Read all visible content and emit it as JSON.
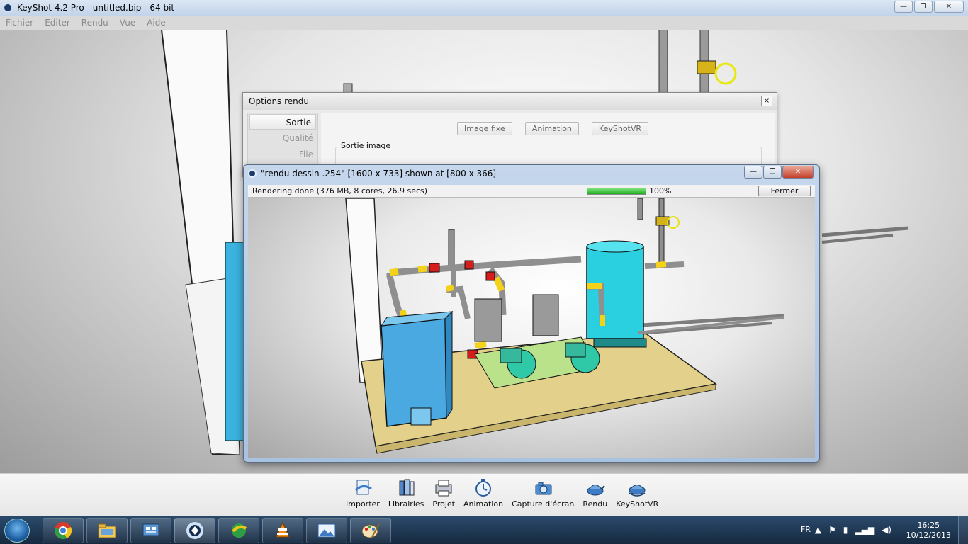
{
  "window": {
    "title": "KeyShot 4.2 Pro  - untitled.bip  - 64 bit",
    "minimize": "—",
    "maximize": "❐",
    "close": "✕"
  },
  "menu": {
    "items": [
      "Fichier",
      "Editer",
      "Rendu",
      "Vue",
      "Aide"
    ]
  },
  "options_dialog": {
    "title": "Options rendu",
    "close": "×",
    "sidebar": [
      "Sortie",
      "Qualité",
      "File"
    ],
    "tabs": [
      "Image fixe",
      "Animation",
      "KeyShotVR"
    ],
    "group_label": "Sortie image"
  },
  "render_window": {
    "title": "\"rendu dessin .254\" [1600 x 733] shown at [800 x 366]",
    "status": "Rendering done (376 MB, 8 cores, 26.9 secs)",
    "progress": 1.0,
    "progress_label": "100%",
    "close_button": "Fermer",
    "minimize": "—",
    "maximize": "❐",
    "close": "✕"
  },
  "toolbar": {
    "items": [
      {
        "label": "Importer",
        "icon": "import-icon"
      },
      {
        "label": "Librairies",
        "icon": "libraries-icon"
      },
      {
        "label": "Projet",
        "icon": "project-icon"
      },
      {
        "label": "Animation",
        "icon": "animation-icon"
      },
      {
        "label": "Capture d'écran",
        "icon": "screenshot-icon"
      },
      {
        "label": "Rendu",
        "icon": "render-icon"
      },
      {
        "label": "KeyShotVR",
        "icon": "keyshotvr-icon"
      }
    ]
  },
  "taskbar": {
    "language": "FR",
    "time": "16:25",
    "date": "10/12/2013",
    "apps": [
      "chrome-icon",
      "explorer-icon",
      "control-panel-icon",
      "keyshot-icon",
      "download-manager-icon",
      "vlc-icon",
      "photo-viewer-icon",
      "paint-icon"
    ]
  },
  "colors": {
    "tank": "#2ad0e0",
    "boiler": "#4aa9e0",
    "floor": "#e3d08a",
    "pipe": "#8f8f8f",
    "pipe_accent": "#f4d21a",
    "valve": "#d81c1c",
    "pump": "#2fc9a8",
    "base": "#b9e28a"
  }
}
